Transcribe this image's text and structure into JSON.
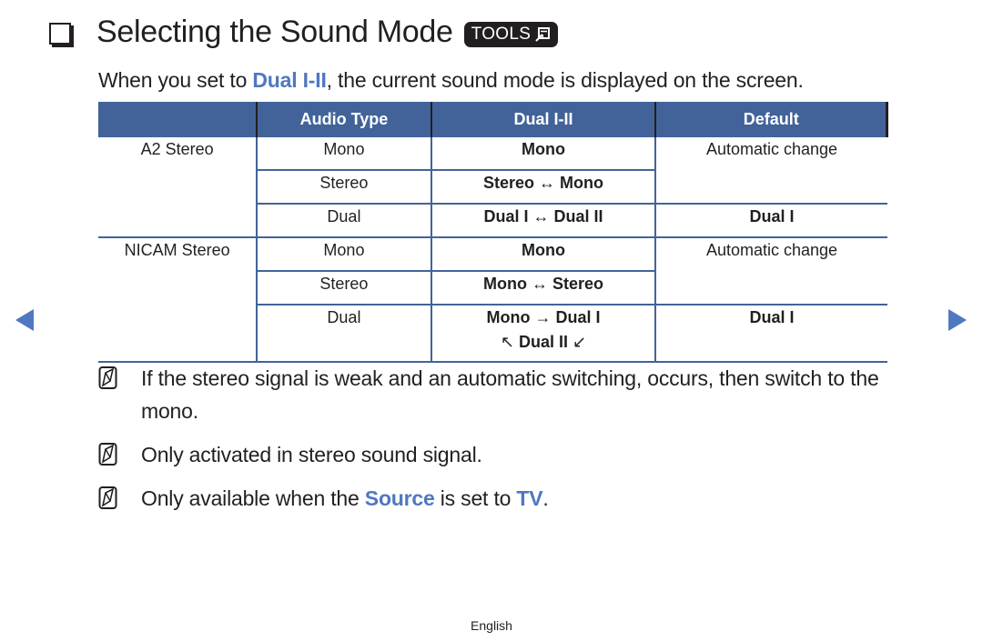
{
  "header": {
    "title": "Selecting the Sound Mode",
    "tools_badge": "TOOLS"
  },
  "intro": {
    "prefix": "When you set to ",
    "highlight": "Dual I-II",
    "suffix": ", the current sound mode is displayed on the screen."
  },
  "table": {
    "headers": [
      "",
      "Audio Type",
      "Dual I-II",
      "Default"
    ],
    "groups": [
      {
        "broadcast": "A2 Stereo",
        "rows": [
          {
            "audio_type": "Mono",
            "dual": "Mono",
            "default": "Automatic change"
          },
          {
            "audio_type": "Stereo",
            "dual_a": "Stereo",
            "arrow": "↔",
            "dual_b": "Mono"
          },
          {
            "audio_type": "Dual",
            "dual_a": "Dual I",
            "arrow": "↔",
            "dual_b": "Dual II",
            "default": "Dual I"
          }
        ]
      },
      {
        "broadcast": "NICAM Stereo",
        "rows": [
          {
            "audio_type": "Mono",
            "dual": "Mono",
            "default": "Automatic change"
          },
          {
            "audio_type": "Stereo",
            "dual_a": "Mono",
            "arrow": "↔",
            "dual_b": "Stereo"
          },
          {
            "audio_type": "Dual",
            "dual_a": "Mono",
            "arrow": "→",
            "dual_b": "Dual I",
            "line2_left_arrow": "↖",
            "line2_text": "Dual II",
            "line2_right_arrow": "↙",
            "default": "Dual I"
          }
        ]
      }
    ]
  },
  "notes": [
    {
      "text": "If the stereo signal is weak and an automatic switching, occurs, then switch to the mono."
    },
    {
      "text": "Only activated in stereo sound signal."
    },
    {
      "prefix": "Only available when the ",
      "hl1": "Source",
      "middle": " is set to ",
      "hl2": "TV",
      "suffix": "."
    }
  ],
  "nav": {
    "prev_icon": "triangle-left-icon",
    "next_icon": "triangle-right-icon"
  },
  "footer": {
    "language": "English"
  },
  "colors": {
    "accent_blue": "#4f78c0",
    "header_blue": "#426399",
    "text": "#231f20"
  }
}
